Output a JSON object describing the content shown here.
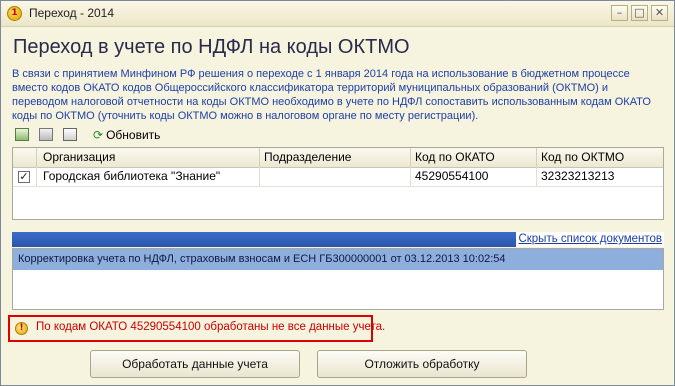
{
  "window": {
    "title": "Переход - 2014",
    "buttons": {
      "minimize": "–",
      "maximize": "□",
      "close": "✕"
    }
  },
  "heading": "Переход в учете по НДФЛ на коды ОКТМО",
  "info_text": "В связи с принятием Минфином РФ решения о переходе с 1 января 2014 года на использование в бюджетном процессе вместо кодов ОКАТО кодов Общероссийского классификатора территорий муниципальных образований (ОКТМО) и переводом налоговой отчетности на коды ОКТМО необходимо в учете по НДФЛ сопоставить использованным кодам ОКАТО коды по ОКТМО (уточнить коды ОКТМО можно в налоговом органе по месту регистрации).",
  "toolbar": {
    "icons": [
      "select-all-icon",
      "copy-icon",
      "toggle-checks-icon"
    ],
    "refresh_label": "Обновить"
  },
  "table": {
    "columns": [
      "Организация",
      "Подразделение",
      "Код по ОКАТО",
      "Код по ОКТМО"
    ],
    "rows": [
      {
        "checked": true,
        "organization": "Городская библиотека \"Знание\"",
        "division": "",
        "okato": "45290554100",
        "oktmo": "32323213213"
      }
    ]
  },
  "documents": {
    "toggle_label": "Скрыть список документов",
    "items": [
      "Корректировка учета по НДФЛ, страховым взносам и ЕСН ГБ300000001 от 03.12.2013 10:02:54"
    ]
  },
  "warning": {
    "text": "По кодам ОКАТО 45290554100 обработаны не все данные учета."
  },
  "actions": {
    "process_label": "Обработать данные учета",
    "postpone_label": "Отложить обработку"
  },
  "colors": {
    "info_text": "#1f3fa8",
    "warning_text": "#cc0000",
    "warning_border": "#dc0000",
    "selected_row": "#8eaede",
    "docs_bar": "#2b56ad"
  }
}
